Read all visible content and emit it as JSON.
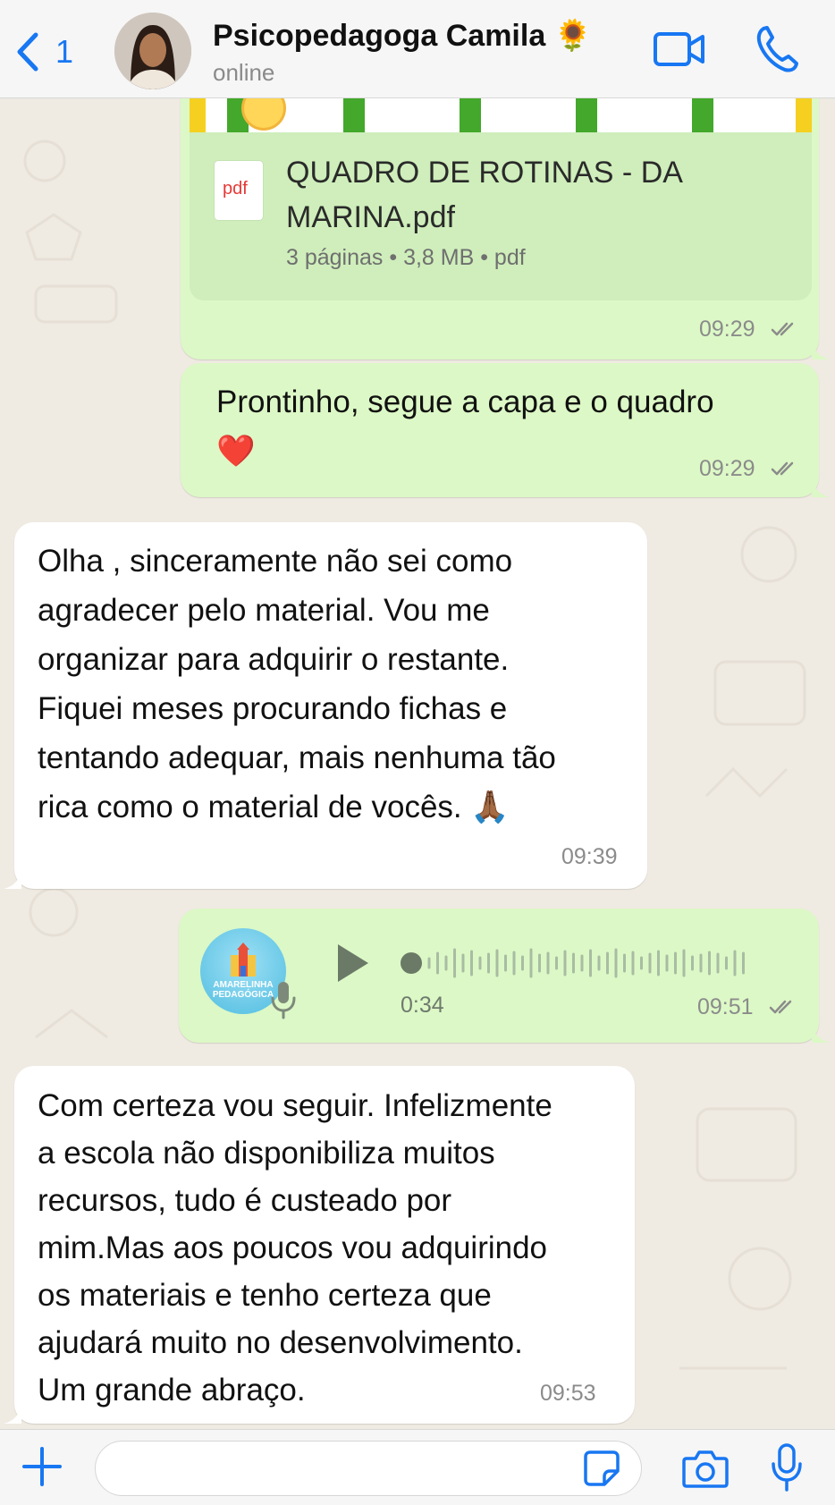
{
  "header": {
    "back_count": "1",
    "contact_name": "Psicopedagoga Camila 🌻",
    "status": "online"
  },
  "messages": [
    {
      "type": "document",
      "direction": "outgoing",
      "file_name": "QUADRO DE ROTINAS - DA MARINA.pdf",
      "file_type_label": "pdf",
      "meta": "3 páginas • 3,8 MB • pdf",
      "time": "09:29",
      "status": "read"
    },
    {
      "type": "text",
      "direction": "outgoing",
      "text": "Prontinho, segue a capa e o quadro\n❤️",
      "time": "09:29",
      "status": "read"
    },
    {
      "type": "text",
      "direction": "incoming",
      "text": "Olha , sinceramente não sei como\nagradecer pelo material. Vou me\norganizar para adquirir o restante.\nFiquei meses procurando fichas e\ntentando adequar, mais nenhuma tão\nrica como o material de vocês. 🙏🏾",
      "time": "09:39"
    },
    {
      "type": "voice",
      "direction": "outgoing",
      "avatar_label": "AMARELINHA PEDAGÓGICA",
      "duration": "0:34",
      "time": "09:51",
      "status": "read"
    },
    {
      "type": "text",
      "direction": "incoming",
      "text": "Com certeza vou seguir. Infelizmente\na escola não disponibiliza muitos\nrecursos, tudo é custeado por\nmim.Mas aos poucos vou adquirindo\nos materiais e tenho certeza que\najudará muito no desenvolvimento.\nUm grande abraço.",
      "time": "09:53"
    }
  ],
  "colors": {
    "outgoing_bubble": "#dcf8c6",
    "incoming_bubble": "#ffffff",
    "accent": "#1877f2",
    "background": "#efeae2"
  },
  "icons": [
    "back-chevron-icon",
    "video-call-icon",
    "phone-icon",
    "pdf-icon",
    "read-ticks-icon",
    "play-icon",
    "microphone-icon",
    "plus-icon",
    "sticker-icon",
    "camera-icon"
  ]
}
